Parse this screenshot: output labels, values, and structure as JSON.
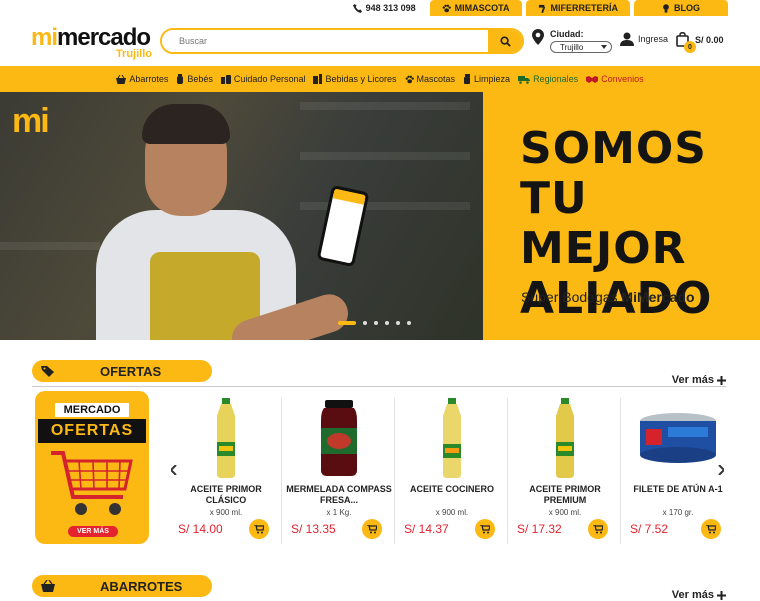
{
  "topbar": {
    "phone": "948 313 098",
    "links": [
      {
        "label": "MIMASCOTA",
        "icon": "paw-icon"
      },
      {
        "label": "MIFERRETERÍA",
        "icon": "hammer-icon"
      },
      {
        "label": "BLOG",
        "icon": "bulb-icon"
      }
    ]
  },
  "header": {
    "logo": {
      "mi": "mi",
      "rest": "mercado",
      "city": "Trujillo"
    },
    "search_placeholder": "Buscar",
    "city_label": "Ciudad:",
    "city_value": "Trujillo",
    "login_label": "Ingresa",
    "cart_total": "S/ 0.00",
    "cart_count": "0"
  },
  "categories": [
    {
      "label": "Abarrotes",
      "icon": "basket-icon"
    },
    {
      "label": "Bebés",
      "icon": "baby-icon"
    },
    {
      "label": "Cuidado Personal",
      "icon": "personal-care-icon"
    },
    {
      "label": "Bebidas y Licores",
      "icon": "bottle-icon"
    },
    {
      "label": "Mascotas",
      "icon": "paw-icon"
    },
    {
      "label": "Limpieza",
      "icon": "spray-icon"
    },
    {
      "label": "Regionales",
      "icon": "truck-icon"
    },
    {
      "label": "Convenios",
      "icon": "handshake-icon"
    }
  ],
  "hero": {
    "brand_mark": "mi",
    "slogan_lines": [
      "SOMOS",
      "TU MEJOR",
      "ALIADO"
    ],
    "subtitle_plain": "Súper Bodegas ",
    "subtitle_bold": "MiMercado",
    "slide_count": 6,
    "active_slide": 1
  },
  "sections": {
    "offers": {
      "title": "OFERTAS",
      "more": "Ver más"
    },
    "groceries": {
      "title": "ABARROTES",
      "more": "Ver más"
    }
  },
  "promo": {
    "line1": "MERCADO",
    "line2": "OFERTAS",
    "cta": "VER MÁS"
  },
  "products": [
    {
      "name": "ACEITE PRIMOR CLÁSICO",
      "qty": "x 900 ml.",
      "price": "S/ 14.00",
      "kind": "oil"
    },
    {
      "name": "MERMELADA COMPASS FRESA...",
      "qty": "x 1 Kg.",
      "price": "S/ 13.35",
      "kind": "jar"
    },
    {
      "name": "ACEITE COCINERO",
      "qty": "x 900 ml.",
      "price": "S/ 14.37",
      "kind": "oil"
    },
    {
      "name": "ACEITE PRIMOR PREMIUM",
      "qty": "x 900 ml.",
      "price": "S/ 17.32",
      "kind": "oil"
    },
    {
      "name": "FILETE DE ATÚN A-1",
      "qty": "x 170 gr.",
      "price": "S/ 7.52",
      "kind": "can"
    }
  ],
  "colors": {
    "brand_yellow": "#fdb913",
    "price_red": "#e4232f",
    "dark": "#141414"
  }
}
